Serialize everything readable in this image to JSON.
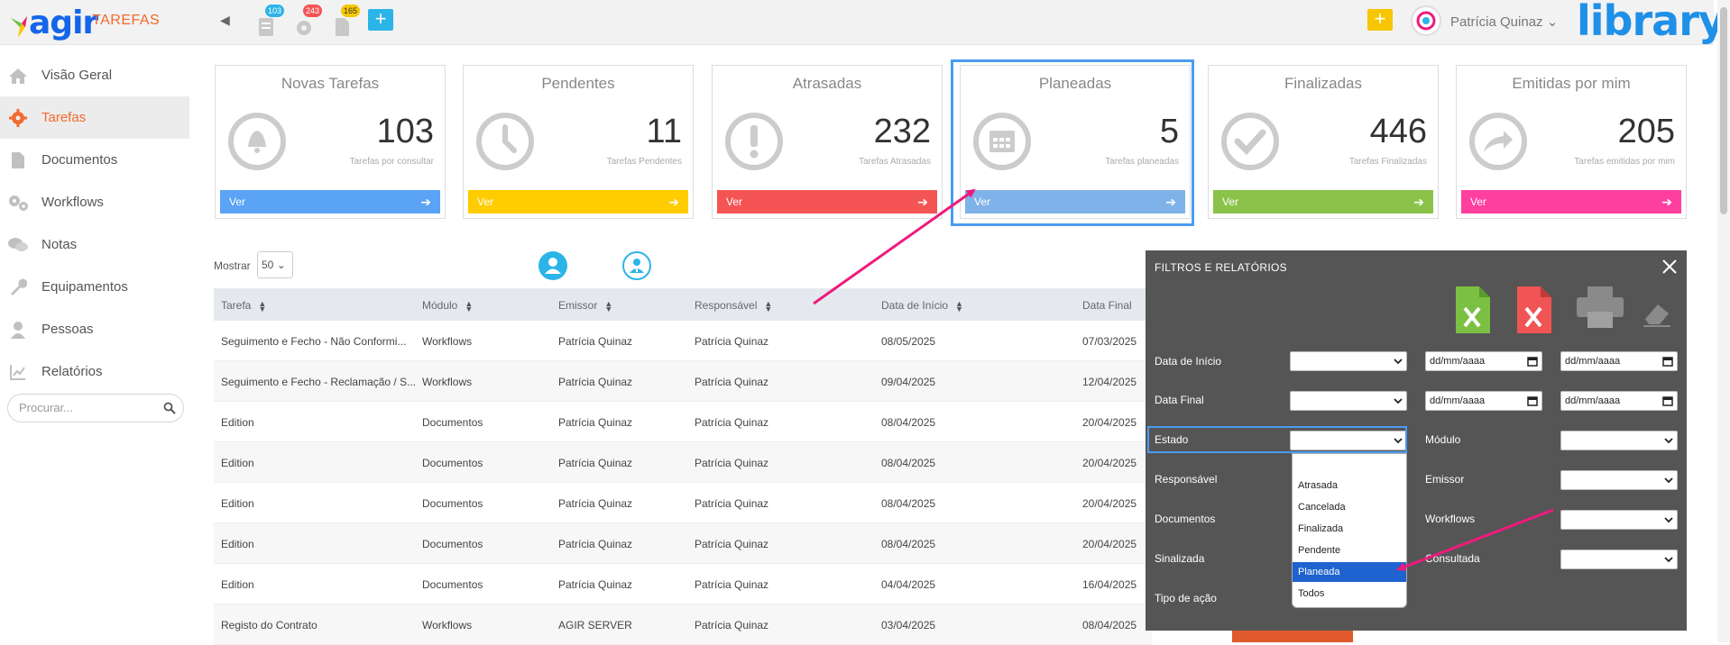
{
  "topbar": {
    "logo_text": "agir",
    "app_name": "TAREFAS",
    "badges": [
      "103",
      "243",
      "165"
    ],
    "user_name": "Patrícia Quinaz",
    "brand": "library",
    "add_symbol": "+"
  },
  "sidebar": {
    "items": [
      {
        "label": "Visão Geral",
        "icon": "home-icon"
      },
      {
        "label": "Tarefas",
        "icon": "gear-icon"
      },
      {
        "label": "Documentos",
        "icon": "document-icon"
      },
      {
        "label": "Workflows",
        "icon": "gears-icon"
      },
      {
        "label": "Notas",
        "icon": "chat-icon"
      },
      {
        "label": "Equipamentos",
        "icon": "wrench-icon"
      },
      {
        "label": "Pessoas",
        "icon": "person-icon"
      },
      {
        "label": "Relatórios",
        "icon": "chart-icon"
      }
    ],
    "active_index": 1,
    "search_placeholder": "Procurar..."
  },
  "cards": [
    {
      "title": "Novas Tarefas",
      "count": "103",
      "subtitle": "Tarefas por consultar",
      "button": "Ver",
      "color": "#5ba3f5",
      "icon": "bell-icon"
    },
    {
      "title": "Pendentes",
      "count": "11",
      "subtitle": "Tarefas Pendentes",
      "button": "Ver",
      "color": "#ffcc00",
      "icon": "clock-icon"
    },
    {
      "title": "Atrasadas",
      "count": "232",
      "subtitle": "Tarefas Atrasadas",
      "button": "Ver",
      "color": "#f55454",
      "icon": "exclamation-icon"
    },
    {
      "title": "Planeadas",
      "count": "5",
      "subtitle": "Tarefas planeadas",
      "button": "Ver",
      "color": "#7fb2e8",
      "icon": "calendar-icon"
    },
    {
      "title": "Finalizadas",
      "count": "446",
      "subtitle": "Tarefas Finalizadas",
      "button": "Ver",
      "color": "#8bc34a",
      "icon": "check-icon"
    },
    {
      "title": "Emitidas por mim",
      "count": "205",
      "subtitle": "Tarefas emitidas por mim",
      "button": "Ver",
      "color": "#ff3fa0",
      "icon": "share-icon"
    }
  ],
  "table": {
    "show_label": "Mostrar",
    "page_size": "50",
    "columns": [
      "Tarefa",
      "Módulo",
      "Emissor",
      "Responsável",
      "Data de Início",
      "Data Final"
    ],
    "rows": [
      [
        "Seguimento e Fecho - Não Conformi...",
        "Workflows",
        "Patrícia Quinaz",
        "Patrícia Quinaz",
        "08/05/2025",
        "07/03/2025"
      ],
      [
        "Seguimento e Fecho - Reclamação / S...",
        "Workflows",
        "Patrícia Quinaz",
        "Patrícia Quinaz",
        "09/04/2025",
        "12/04/2025"
      ],
      [
        "Edition",
        "Documentos",
        "Patrícia Quinaz",
        "Patrícia Quinaz",
        "08/04/2025",
        "20/04/2025"
      ],
      [
        "Edition",
        "Documentos",
        "Patrícia Quinaz",
        "Patrícia Quinaz",
        "08/04/2025",
        "20/04/2025"
      ],
      [
        "Edition",
        "Documentos",
        "Patrícia Quinaz",
        "Patrícia Quinaz",
        "08/04/2025",
        "20/04/2025"
      ],
      [
        "Edition",
        "Documentos",
        "Patrícia Quinaz",
        "Patrícia Quinaz",
        "08/04/2025",
        "20/04/2025"
      ],
      [
        "Edition",
        "Documentos",
        "Patrícia Quinaz",
        "Patrícia Quinaz",
        "04/04/2025",
        "16/04/2025"
      ],
      [
        "Registo do Contrato",
        "Workflows",
        "AGIR SERVER",
        "Patrícia Quinaz",
        "03/04/2025",
        "08/04/2025"
      ]
    ]
  },
  "modal": {
    "title": "FILTROS E RELATÓRIOS",
    "labels_left": [
      "Data de Início",
      "Data Final",
      "Estado",
      "Responsável",
      "Documentos",
      "Sinalizada",
      "Tipo de ação"
    ],
    "labels_right": [
      "Módulo",
      "Emissor",
      "Workflows",
      "Consultada"
    ],
    "date_placeholder": "dd/mm/aaaa",
    "estado_options": [
      "Atrasada",
      "Cancelada",
      "Finalizada",
      "Pendente",
      "Planeada",
      "Todos"
    ],
    "estado_selected_index": 4,
    "export_icons": [
      "excel-icon",
      "pdf-icon",
      "print-icon",
      "eraser-icon"
    ]
  },
  "colors": {
    "accent": "#f26a2e",
    "highlight": "#4a9cf0",
    "arrow": "#ee1a7d",
    "modal_bg": "#555555"
  }
}
